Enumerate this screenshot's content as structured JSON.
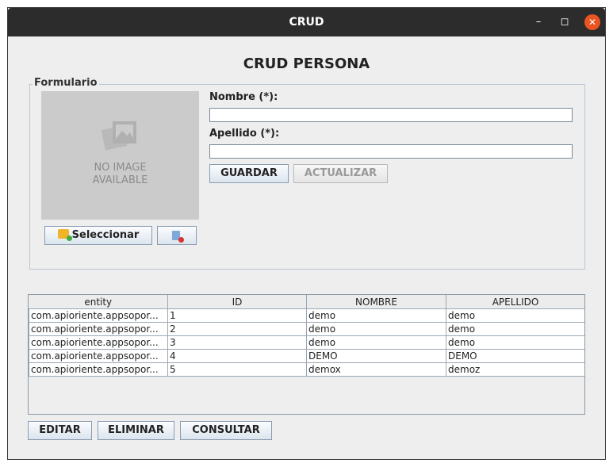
{
  "window": {
    "title": "CRUD"
  },
  "heading": "CRUD PERSONA",
  "form": {
    "legend": "Formulario",
    "image_text_line1": "NO IMAGE",
    "image_text_line2": "AVAILABLE",
    "select_label": "Seleccionar",
    "nombre_label": "Nombre (*):",
    "nombre_value": "",
    "apellido_label": "Apellido (*):",
    "apellido_value": "",
    "guardar_label": "GUARDAR",
    "actualizar_label": "ACTUALIZAR"
  },
  "table": {
    "columns": [
      "entity",
      "ID",
      "NOMBRE",
      "APELLIDO"
    ],
    "rows": [
      [
        "com.apioriente.appsopor...",
        "1",
        "demo",
        "demo"
      ],
      [
        "com.apioriente.appsopor...",
        "2",
        "demo",
        "demo"
      ],
      [
        "com.apioriente.appsopor...",
        "3",
        "demo",
        "demo"
      ],
      [
        "com.apioriente.appsopor...",
        "4",
        "DEMO",
        "DEMO"
      ],
      [
        "com.apioriente.appsopor...",
        "5",
        "demox",
        "demoz"
      ]
    ]
  },
  "actions": {
    "editar_label": "EDITAR",
    "eliminar_label": "ELIMINAR",
    "consultar_label": "CONSULTAR"
  },
  "icons": [
    "minimize-icon",
    "maximize-icon",
    "close-icon",
    "no-image-icon",
    "folder-add-icon",
    "remove-image-icon"
  ],
  "colors": {
    "titlebar": "#2c2c2c",
    "close": "#e95420",
    "panel": "#eeeeee"
  }
}
